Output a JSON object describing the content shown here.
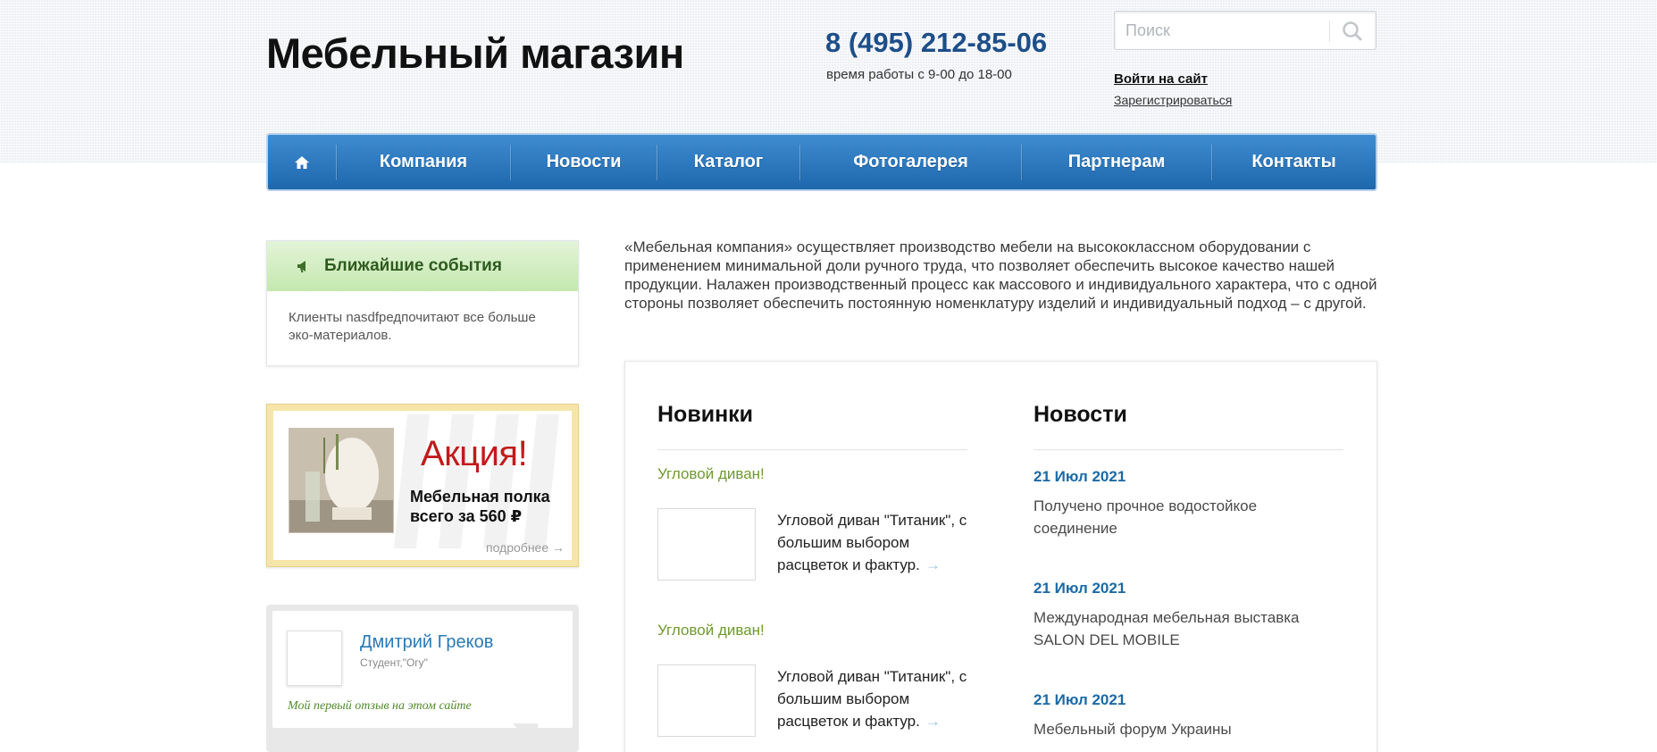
{
  "header": {
    "site_title": "Мебельный магазин",
    "phone": "8 (495) 212-85-06",
    "hours": "время работы с 9-00 до 18-00",
    "search_placeholder": "Поиск",
    "login": "Войти на сайт",
    "register": "Зарегистрироваться"
  },
  "nav": {
    "home_icon": "home-icon",
    "items": [
      {
        "label": "Компания"
      },
      {
        "label": "Новости"
      },
      {
        "label": "Каталог"
      },
      {
        "label": "Фотогалерея"
      },
      {
        "label": "Партнерам"
      },
      {
        "label": "Контакты"
      }
    ]
  },
  "sidebar": {
    "events": {
      "icon": "megaphone-icon",
      "title": "Ближайшие события",
      "text": "Клиенты nasdfредпочитают все больше эко-материалов."
    },
    "promo": {
      "title": "Акция!",
      "text": "Мебельная полка всего за 560 ₽",
      "more": "подробнее →"
    },
    "review": {
      "name": "Дмитрий Греков",
      "role": "Студент,\"Огу\"",
      "quote": "Мой первый отзыв на этом сайте"
    }
  },
  "main": {
    "intro": "«Мебельная компания» осуществляет производство мебели на высококлассном оборудовании с применением минимальной доли ручного труда, что позволяет обеспечить высокое качество нашей продукции. Налажен производственный процесс как массового и индивидуального характера, что с одной стороны позволяет обеспечить постоянную номенклатуру изделий и индивидуальный подход – с другой.",
    "new_products": {
      "title": "Новинки",
      "items": [
        {
          "name": "Угловой диван!",
          "desc": "Угловой диван \"Титаник\", с большим выбором расцветок и фактур."
        },
        {
          "name": "Угловой диван!",
          "desc": "Угловой диван \"Титаник\", с большим выбором расцветок и фактур."
        }
      ]
    },
    "news": {
      "title": "Новости",
      "items": [
        {
          "date": "21 Июл 2021",
          "title": "Получено прочное водостойкое соединение"
        },
        {
          "date": "21 Июл 2021",
          "title": "Международная мебельная выставка SALON DEL MOBILE"
        },
        {
          "date": "21 Июл 2021",
          "title": "Мебельный форум Украины"
        }
      ]
    }
  },
  "colors": {
    "nav_top": "#3f8cd1",
    "nav_bottom": "#1e67ad",
    "phone": "#1d4e89",
    "promo_red": "#c11b1b",
    "green_link": "#6f9a2e",
    "news_date": "#1a6aa6"
  }
}
